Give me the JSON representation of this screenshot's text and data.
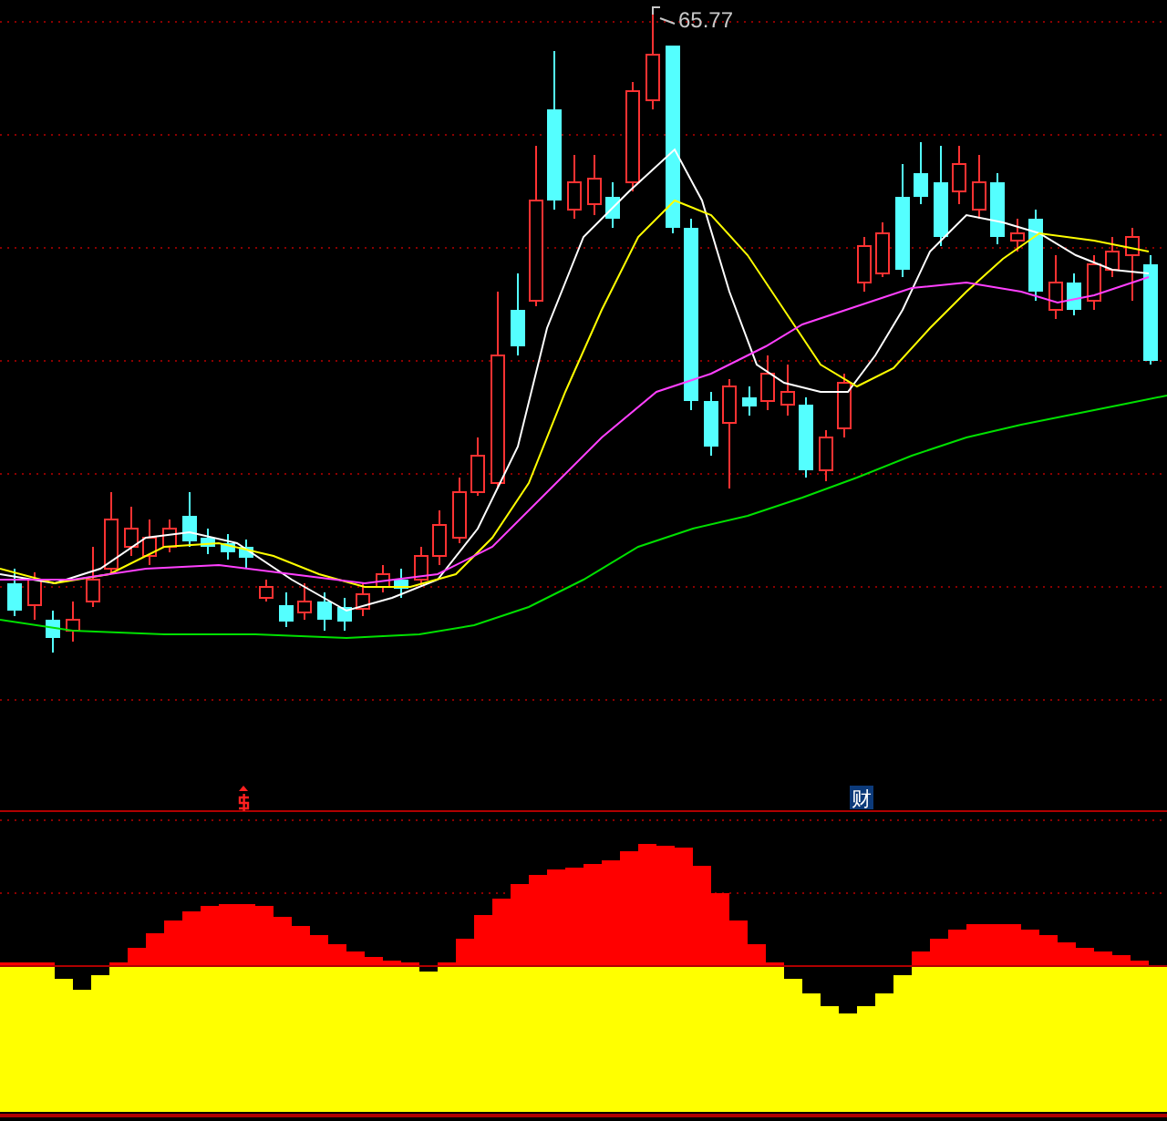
{
  "price_panel": {
    "high_label": "65.77"
  },
  "indicator_panel": {
    "signal_badge": "财"
  }
}
